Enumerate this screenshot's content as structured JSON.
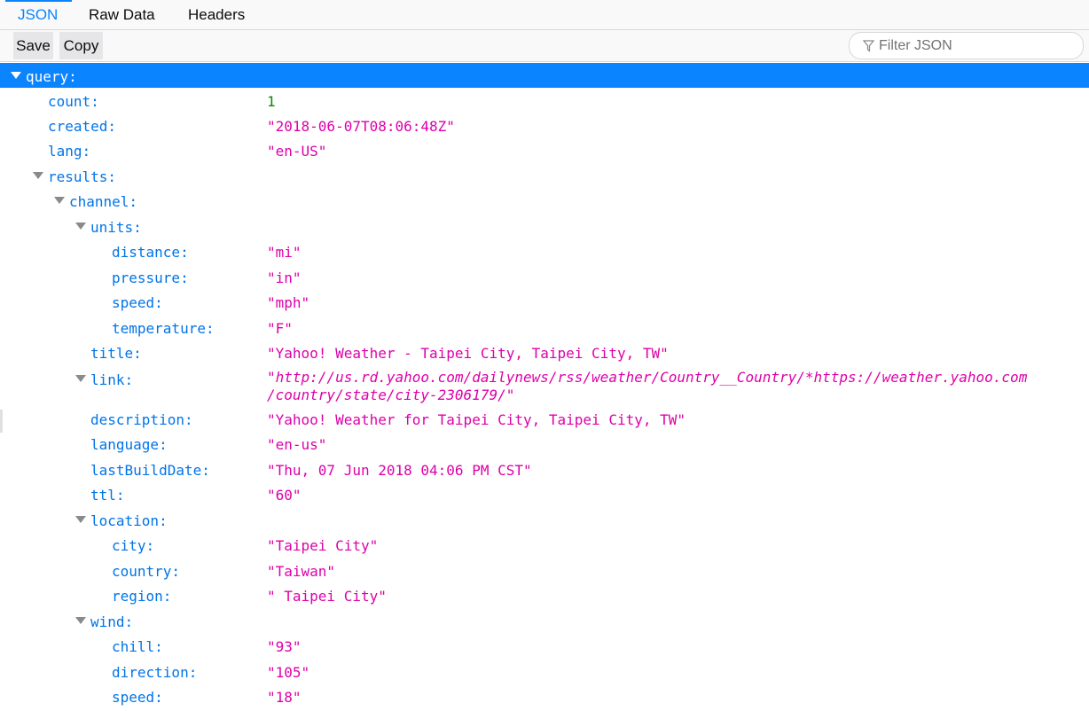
{
  "tabs": [
    {
      "label": "JSON",
      "active": true
    },
    {
      "label": "Raw Data",
      "active": false
    },
    {
      "label": "Headers",
      "active": false
    }
  ],
  "toolbar": {
    "save_label": "Save",
    "copy_label": "Copy"
  },
  "filter": {
    "placeholder": "Filter JSON",
    "icon": "filter-icon"
  },
  "colors": {
    "accent": "#0a84ff",
    "key": "#0074e8",
    "string": "#dd00a9",
    "number": "#058b00"
  },
  "tree": {
    "query": "query:",
    "count": {
      "key": "count:",
      "value": "1"
    },
    "created": {
      "key": "created:",
      "value": "\"2018-06-07T08:06:48Z\""
    },
    "lang": {
      "key": "lang:",
      "value": "\"en-US\""
    },
    "results": "results:",
    "channel": "channel:",
    "units": "units:",
    "distance": {
      "key": "distance:",
      "value": "\"mi\""
    },
    "pressure": {
      "key": "pressure:",
      "value": "\"in\""
    },
    "speed_unit": {
      "key": "speed:",
      "value": "\"mph\""
    },
    "temperature": {
      "key": "temperature:",
      "value": "\"F\""
    },
    "title": {
      "key": "title:",
      "value": "\"Yahoo! Weather - Taipei City, Taipei City, TW\""
    },
    "link": {
      "key": "link:",
      "value_line1": "\"http://us.rd.yahoo.com/dailynews/rss/weather/Country__Country/*https://weather.yahoo.com",
      "value_line2": "/country/state/city-2306179/\""
    },
    "description": {
      "key": "description:",
      "value": "\"Yahoo! Weather for Taipei City, Taipei City, TW\""
    },
    "language": {
      "key": "language:",
      "value": "\"en-us\""
    },
    "lastBuildDate": {
      "key": "lastBuildDate:",
      "value": "\"Thu, 07 Jun 2018 04:06 PM CST\""
    },
    "ttl": {
      "key": "ttl:",
      "value": "\"60\""
    },
    "location": "location:",
    "city": {
      "key": "city:",
      "value": "\"Taipei City\""
    },
    "country": {
      "key": "country:",
      "value": "\"Taiwan\""
    },
    "region": {
      "key": "region:",
      "value": "\" Taipei City\""
    },
    "wind": "wind:",
    "chill": {
      "key": "chill:",
      "value": "\"93\""
    },
    "direction": {
      "key": "direction:",
      "value": "\"105\""
    },
    "speed_wind": {
      "key": "speed:",
      "value": "\"18\""
    }
  }
}
